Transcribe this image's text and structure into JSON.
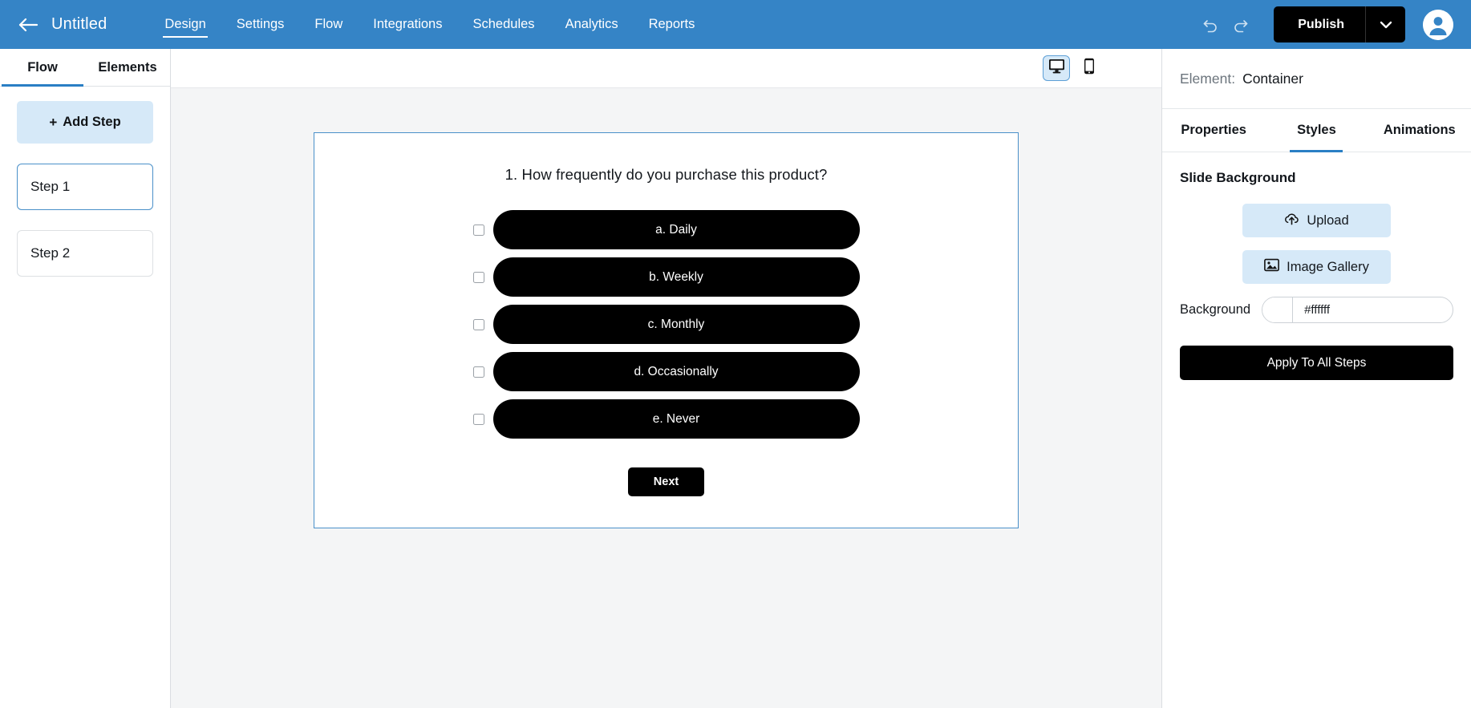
{
  "topbar": {
    "back_icon": "arrow-left-icon",
    "doc_title": "Untitled",
    "nav": [
      {
        "label": "Design",
        "active": true
      },
      {
        "label": "Settings",
        "active": false
      },
      {
        "label": "Flow",
        "active": false
      },
      {
        "label": "Integrations",
        "active": false
      },
      {
        "label": "Schedules",
        "active": false
      },
      {
        "label": "Analytics",
        "active": false
      },
      {
        "label": "Reports",
        "active": false
      }
    ],
    "undo_icon": "undo-icon",
    "redo_icon": "redo-icon",
    "publish_label": "Publish",
    "publish_caret_icon": "chevron-down-icon",
    "avatar_icon": "user-avatar-icon",
    "accent_color": "#3584c6",
    "publish_bg": "#000000"
  },
  "left_panel": {
    "tabs": [
      {
        "label": "Flow",
        "active": true
      },
      {
        "label": "Elements",
        "active": false
      }
    ],
    "add_step_label": "Add Step",
    "add_step_plus": "+",
    "steps": [
      {
        "label": "Step 1",
        "selected": true
      },
      {
        "label": "Step 2",
        "selected": false
      }
    ]
  },
  "canvas": {
    "devices": [
      {
        "name": "desktop-view",
        "icon": "monitor-icon",
        "active": true
      },
      {
        "name": "mobile-view",
        "icon": "phone-icon",
        "active": false
      }
    ],
    "slide": {
      "question": "1. How frequently do you purchase this product?",
      "options": [
        {
          "label": "a. Daily",
          "checked": false
        },
        {
          "label": "b. Weekly",
          "checked": false
        },
        {
          "label": "c. Monthly",
          "checked": false
        },
        {
          "label": "d. Occasionally",
          "checked": false
        },
        {
          "label": "e. Never",
          "checked": false
        }
      ],
      "next_label": "Next",
      "option_bg": "#000000",
      "border_color": "#4a90c9"
    }
  },
  "right_panel": {
    "element_label": "Element:",
    "element_value": "Container",
    "tabs": [
      {
        "label": "Properties",
        "active": false
      },
      {
        "label": "Styles",
        "active": true
      },
      {
        "label": "Animations",
        "active": false
      }
    ],
    "section_title": "Slide Background",
    "upload_label": "Upload",
    "upload_icon": "cloud-upload-icon",
    "gallery_label": "Image Gallery",
    "gallery_icon": "image-icon",
    "background_label": "Background",
    "background_value": "#ffffff",
    "apply_label": "Apply To All Steps"
  }
}
